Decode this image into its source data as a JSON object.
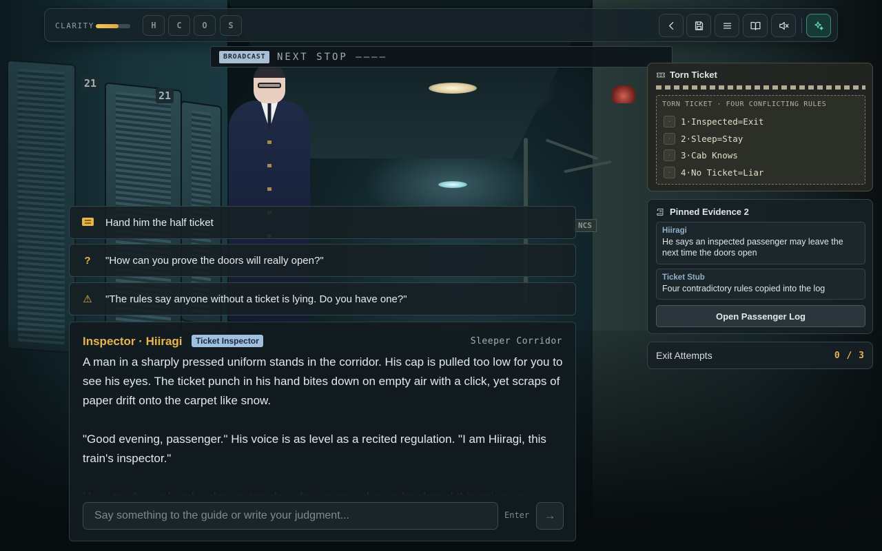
{
  "colors": {
    "accent_gold": "#e9b54b",
    "accent_teal": "#63d6c0",
    "badge_blue": "#9fc0de",
    "panel_bg": "#161f24"
  },
  "topbar": {
    "clarity_label": "CLARITY",
    "clarity_level": 0.65,
    "stats": [
      "H",
      "C",
      "O",
      "S"
    ],
    "buttons": [
      {
        "name": "back-button",
        "icon": "chevron-left-icon"
      },
      {
        "name": "save-button",
        "icon": "save-icon"
      },
      {
        "name": "menu-button",
        "icon": "menu-icon"
      },
      {
        "name": "journal-button",
        "icon": "book-icon"
      },
      {
        "name": "mute-button",
        "icon": "speaker-muted-icon"
      },
      {
        "name": "effects-button",
        "icon": "sparkles-icon"
      }
    ]
  },
  "broadcast": {
    "tag": "BROADCAST",
    "text": "NEXT STOP ————"
  },
  "choices": [
    {
      "icon": "ticket-icon",
      "label": "Hand him the half ticket"
    },
    {
      "icon": "question-icon",
      "icon_glyph": "?",
      "label": "\"How can you prove the doors will really open?\""
    },
    {
      "icon": "warning-icon",
      "icon_glyph": "⚠",
      "label": "\"The rules say anyone without a ticket is lying. Do you have one?\""
    }
  ],
  "dialogue": {
    "speaker": "Inspector · Hiiragi",
    "role": "Ticket Inspector",
    "location": "Sleeper Corridor",
    "paragraphs": [
      "A man in a sharply pressed uniform stands in the corridor. His cap is pulled too low for you to see his eyes. The ticket punch in his hand bites down on empty air with a click, yet scraps of paper drift onto the carpet like snow.",
      "\"Good evening, passenger.\" His voice is as level as a recited regulation. \"I am Hiiragi, this train's inspector.\"",
      "He extends one hand, palm up, too clean for anyone who works aboard this aging car."
    ],
    "input_placeholder": "Say something to the guide or write your judgment...",
    "enter_hint": "Enter",
    "send_glyph": "→"
  },
  "ticket": {
    "title": "Torn Ticket",
    "rules_header": "TORN TICKET · FOUR CONFLICTING RULES",
    "bullet_glyph": "·",
    "rules": [
      "1·Inspected=Exit",
      "2·Sleep=Stay",
      "3·Cab Knows",
      "4·No Ticket=Liar"
    ]
  },
  "evidence": {
    "title": "Pinned Evidence 2",
    "items": [
      {
        "source": "Hiiragi",
        "text": "He says an inspected passenger may leave the next time the doors open"
      },
      {
        "source": "Ticket Stub",
        "text": "Four contradictory rules copied into the log"
      }
    ],
    "button_label": "Open Passenger Log"
  },
  "attempts": {
    "label": "Exit Attempts",
    "value": "0 / 3"
  }
}
